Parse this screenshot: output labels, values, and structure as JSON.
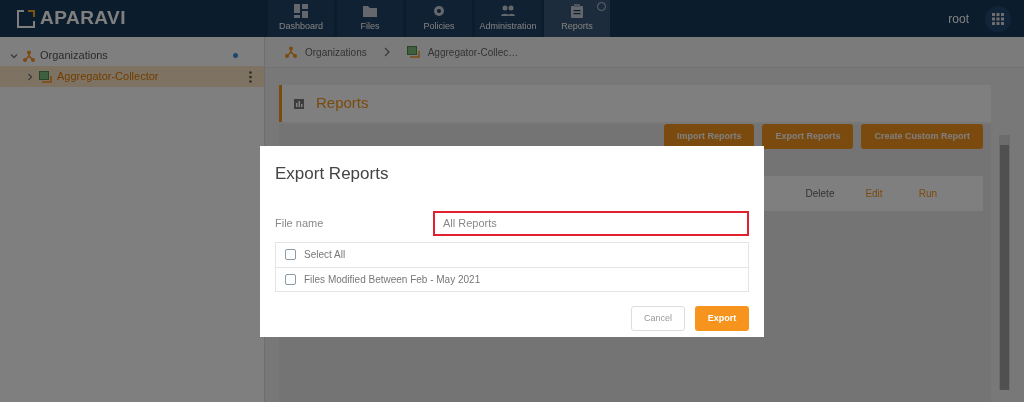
{
  "top_bar": {
    "logo": "APARAVI",
    "nav": [
      {
        "label": "Dashboard",
        "selected": false
      },
      {
        "label": "Files",
        "selected": false
      },
      {
        "label": "Policies",
        "selected": false
      },
      {
        "label": "Administration",
        "selected": false
      },
      {
        "label": "Reports",
        "selected": true
      }
    ],
    "user": "root"
  },
  "sidebar": {
    "tree": [
      {
        "label": "Organizations",
        "expanded": true,
        "selected": false,
        "children": [
          {
            "label": "Aggregator-Collector",
            "expanded": false,
            "selected": true
          }
        ]
      }
    ]
  },
  "breadcrumb": [
    "Organizations",
    "Aggregator-Collec…"
  ],
  "reports_panel": {
    "title": "Reports",
    "buttons": [
      "Import Reports",
      "Export Reports",
      "Create Custom Report"
    ],
    "row_actions": [
      {
        "label": "Delete",
        "kind": "neutral"
      },
      {
        "label": "Edit",
        "kind": "accent"
      },
      {
        "label": "Run",
        "kind": "accent"
      }
    ]
  },
  "dialog": {
    "title": "Export Reports",
    "file_name_label": "File name",
    "file_name_value": "All Reports",
    "items": [
      {
        "label": "Select All",
        "checked": false
      },
      {
        "label": "Files Modified Between Feb - May 2021",
        "checked": false
      }
    ],
    "buttons": [
      {
        "label": "Cancel",
        "kind": "secondary"
      },
      {
        "label": "Export",
        "kind": "primary"
      }
    ]
  }
}
